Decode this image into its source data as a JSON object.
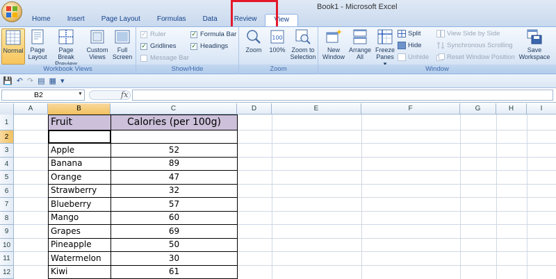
{
  "window": {
    "title": "Book1 - Microsoft Excel"
  },
  "tabs": [
    {
      "label": "Home"
    },
    {
      "label": "Insert"
    },
    {
      "label": "Page Layout"
    },
    {
      "label": "Formulas"
    },
    {
      "label": "Data"
    },
    {
      "label": "Review"
    },
    {
      "label": "View"
    }
  ],
  "ribbon": {
    "workbook_views": {
      "label": "Workbook Views",
      "normal": "Normal",
      "page_layout_1": "Page",
      "page_layout_2": "Layout",
      "page_break_1": "Page Break",
      "page_break_2": "Preview",
      "custom_views_1": "Custom",
      "custom_views_2": "Views",
      "full_screen_1": "Full",
      "full_screen_2": "Screen"
    },
    "show_hide": {
      "label": "Show/Hide",
      "ruler": "Ruler",
      "gridlines": "Gridlines",
      "message_bar": "Message Bar",
      "formula_bar": "Formula Bar",
      "headings": "Headings"
    },
    "zoom": {
      "label": "Zoom",
      "zoom": "Zoom",
      "hundred": "100%",
      "zoom_sel_1": "Zoom to",
      "zoom_sel_2": "Selection"
    },
    "window": {
      "label": "Window",
      "new_window_1": "New",
      "new_window_2": "Window",
      "arrange_1": "Arrange",
      "arrange_2": "All",
      "freeze_1": "Freeze",
      "freeze_2": "Panes",
      "split": "Split",
      "hide": "Hide",
      "unhide": "Unhide",
      "side_by_side": "View Side by Side",
      "sync_scroll": "Synchronous Scrolling",
      "reset_pos": "Reset Window Position",
      "save_ws_1": "Save",
      "save_ws_2": "Workspace"
    }
  },
  "formula_bar": {
    "name_box": "B2",
    "fx": "fx",
    "value": ""
  },
  "columns": [
    "A",
    "B",
    "C",
    "D",
    "E",
    "F",
    "G",
    "H",
    "I"
  ],
  "rows": [
    "1",
    "2",
    "3",
    "4",
    "5",
    "6",
    "7",
    "8",
    "9",
    "10",
    "11",
    "12"
  ],
  "table": {
    "header_fruit": "Fruit",
    "header_calories": "Calories (per 100g)",
    "fruits": [
      "Apple",
      "Banana",
      "Orange",
      "Strawberry",
      "Blueberry",
      "Mango",
      "Grapes",
      "Pineapple",
      "Watermelon",
      "Kiwi"
    ],
    "calories": [
      "52",
      "89",
      "47",
      "32",
      "57",
      "60",
      "69",
      "50",
      "30",
      "61"
    ]
  }
}
